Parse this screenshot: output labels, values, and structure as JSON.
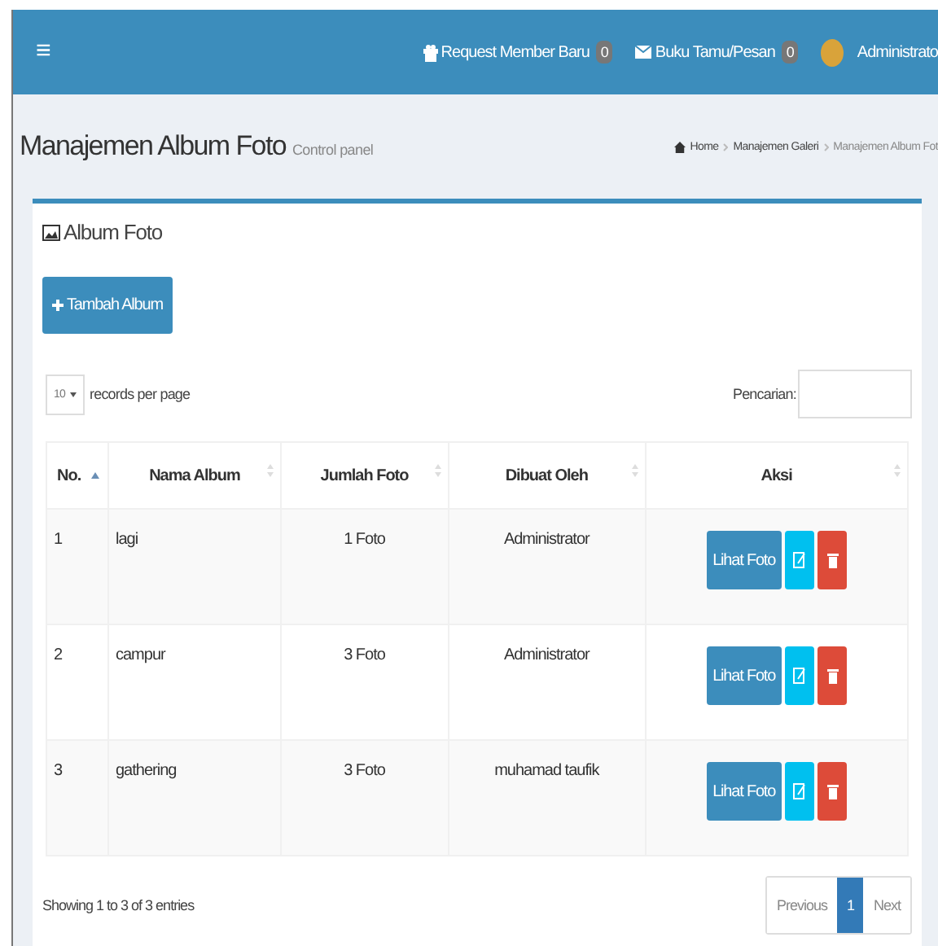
{
  "navbar": {
    "menu_icon": "≡",
    "items": [
      {
        "kind": "badge",
        "label": "Request Member Baru",
        "count": "0"
      },
      {
        "kind": "badge",
        "label": "Buku Tamu/Pesan",
        "count": "0"
      },
      {
        "kind": "user",
        "label": "Administrato"
      }
    ]
  },
  "page_header": {
    "title": "Manajemen Album Foto",
    "subtitle": "Control panel",
    "breadcrumb": [
      "Home",
      "Manajemen Galeri",
      "Manajemen Album Fot"
    ]
  },
  "box": {
    "title": "Album Foto",
    "add_button": "Tambah Album",
    "length": {
      "value": "10",
      "label": "records per page"
    },
    "search": {
      "label": "Pencarian:"
    },
    "table": {
      "columns": [
        {
          "label": "No.",
          "sorted": true
        },
        {
          "label": "Nama Album",
          "sorted": false
        },
        {
          "label": "Jumlah Foto",
          "sorted": false
        },
        {
          "label": "Dibuat Oleh",
          "sorted": false
        },
        {
          "label": "Aksi",
          "sorted": false
        }
      ],
      "rows": [
        {
          "no": "1",
          "name": "lagi",
          "count": "1 Foto",
          "author": "Administrator",
          "view": "Lihat Foto"
        },
        {
          "no": "2",
          "name": "campur",
          "count": "3 Foto",
          "author": "Administrator",
          "view": "Lihat Foto"
        },
        {
          "no": "3",
          "name": "gathering",
          "count": "3 Foto",
          "author": "muhamad taufik",
          "view": "Lihat Foto"
        }
      ]
    },
    "info": "Showing 1 to 3 of 3 entries",
    "pagination": [
      {
        "label": "Previous",
        "selected": false
      },
      {
        "label": "1",
        "selected": true
      },
      {
        "label": "Next",
        "selected": false
      }
    ]
  }
}
